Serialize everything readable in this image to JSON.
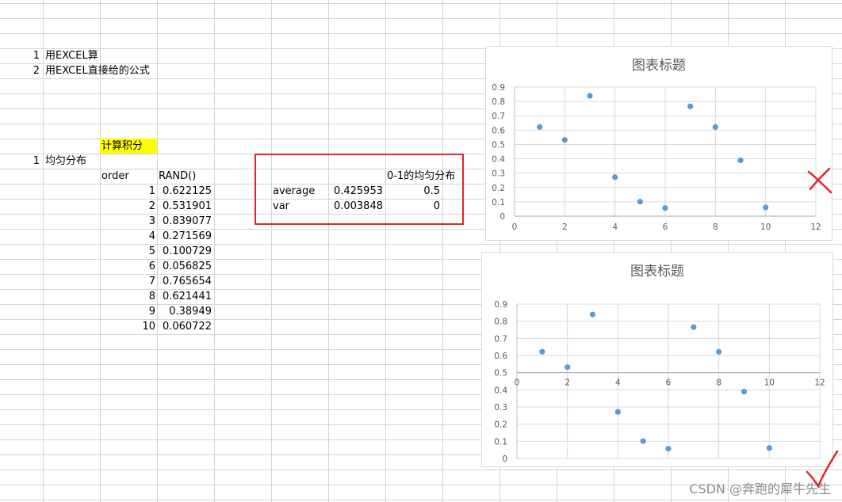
{
  "notes": [
    {
      "num": "1",
      "text": "用EXCEL算"
    },
    {
      "num": "2",
      "text": "用EXCEL直接给的公式"
    }
  ],
  "highlight_label": "计算积分",
  "section": {
    "num": "1",
    "text": "均匀分布"
  },
  "table": {
    "headers": [
      "order",
      "RAND()"
    ],
    "rows": [
      {
        "order": "1",
        "rand": "0.622125"
      },
      {
        "order": "2",
        "rand": "0.531901"
      },
      {
        "order": "3",
        "rand": "0.839077"
      },
      {
        "order": "4",
        "rand": "0.271569"
      },
      {
        "order": "5",
        "rand": "0.100729"
      },
      {
        "order": "6",
        "rand": "0.056825"
      },
      {
        "order": "7",
        "rand": "0.765654"
      },
      {
        "order": "8",
        "rand": "0.621441"
      },
      {
        "order": "9",
        "rand": "0.38949"
      },
      {
        "order": "10",
        "rand": "0.060722"
      }
    ]
  },
  "stats": {
    "header": "0-1的均匀分布",
    "rows": [
      {
        "label": "average",
        "value": "0.425953",
        "theory": "0.5"
      },
      {
        "label": "var",
        "value": "0.003848",
        "theory": "0"
      }
    ]
  },
  "chart_data": [
    {
      "type": "scatter",
      "title": "图表标题",
      "x": [
        1,
        2,
        3,
        4,
        5,
        6,
        7,
        8,
        9,
        10
      ],
      "y": [
        0.622125,
        0.531901,
        0.839077,
        0.271569,
        0.100729,
        0.056825,
        0.765654,
        0.621441,
        0.38949,
        0.060722
      ],
      "xlim": [
        0,
        12
      ],
      "ylim": [
        0,
        0.9
      ],
      "xticks": [
        "0",
        "2",
        "4",
        "6",
        "8",
        "10",
        "12"
      ],
      "yticks": [
        "0",
        "0.1",
        "0.2",
        "0.3",
        "0.4",
        "0.5",
        "0.6",
        "0.7",
        "0.8",
        "0.9"
      ],
      "x_axis_crosses_y_at": 0,
      "grid": true,
      "color": "#5b9bd5"
    },
    {
      "type": "scatter",
      "title": "图表标题",
      "x": [
        1,
        2,
        3,
        4,
        5,
        6,
        7,
        8,
        9,
        10
      ],
      "y": [
        0.622125,
        0.531901,
        0.839077,
        0.271569,
        0.100729,
        0.056825,
        0.765654,
        0.621441,
        0.38949,
        0.060722
      ],
      "xlim": [
        0,
        12
      ],
      "ylim": [
        0,
        0.9
      ],
      "xticks": [
        "0",
        "2",
        "4",
        "6",
        "8",
        "10",
        "12"
      ],
      "yticks": [
        "0",
        "0.1",
        "0.2",
        "0.3",
        "0.4",
        "0.5",
        "0.6",
        "0.7",
        "0.8",
        "0.9"
      ],
      "x_axis_crosses_y_at": 0.5,
      "grid": true,
      "color": "#5b9bd5"
    }
  ],
  "annotations": {
    "wrong_mark": "cross-mark-icon",
    "right_mark": "check-mark-icon",
    "color": "#e0262b"
  },
  "watermark": "CSDN @奔跑的犀牛先生"
}
